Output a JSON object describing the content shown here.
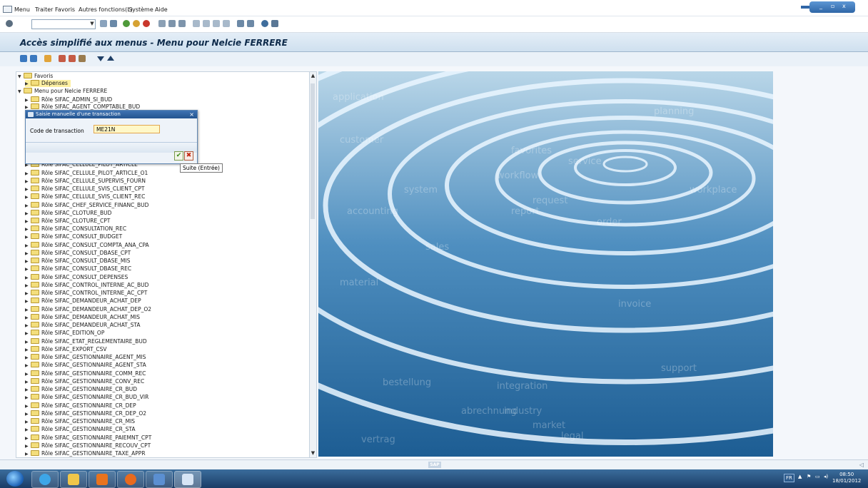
{
  "menubar": {
    "items": [
      "Menu",
      "Traiter",
      "Favoris",
      "Autres fonctions(L)",
      "Système",
      "Aide"
    ]
  },
  "window": {
    "minimize": "_",
    "restore": "▫",
    "close": "x"
  },
  "toolbar": {
    "command_field_value": ""
  },
  "title": "Accès simplifié aux menus  -  Menu pour Nelcie FERRERE",
  "tree": {
    "items": [
      "Favoris",
      "Dépenses",
      "Menu pour Nelcie FERRERE",
      "Rôle SIFAC_ADMIN_SI_BUD",
      "Rôle SIFAC_AGENT_COMPTABLE_BUD",
      "Rôle SIFAC_CELLULE_PILOT_ARTICLE",
      "Rôle SIFAC_CELLULE_PILOT_ARTICLE_O1",
      "Rôle SIFAC_CELLULE_SUPERVIS_FOURN",
      "Rôle SIFAC_CELLULE_SVIS_CLIENT_CPT",
      "Rôle SIFAC_CELLULE_SVIS_CLIENT_REC",
      "Rôle SIFAC_CHEF_SERVICE_FINANC_BUD",
      "Rôle SIFAC_CLOTURE_BUD",
      "Rôle SIFAC_CLOTURE_CPT",
      "Rôle SIFAC_CONSULTATION_REC",
      "Rôle SIFAC_CONSULT_BUDGET",
      "Rôle SIFAC_CONSULT_COMPTA_ANA_CPA",
      "Rôle SIFAC_CONSULT_DBASE_CPT",
      "Rôle SIFAC_CONSULT_DBASE_MIS",
      "Rôle SIFAC_CONSULT_DBASE_REC",
      "Rôle SIFAC_CONSULT_DEPENSES",
      "Rôle SIFAC_CONTROL_INTERNE_AC_BUD",
      "Rôle SIFAC_CONTROL_INTERNE_AC_CPT",
      "Rôle SIFAC_DEMANDEUR_ACHAT_DEP",
      "Rôle SIFAC_DEMANDEUR_ACHAT_DEP_O2",
      "Rôle SIFAC_DEMANDEUR_ACHAT_MIS",
      "Rôle SIFAC_DEMANDEUR_ACHAT_STA",
      "Rôle SIFAC_EDITION_OP",
      "Rôle SIFAC_ETAT_REGLEMENTAIRE_BUD",
      "Rôle SIFAC_EXPORT_CSV",
      "Rôle SIFAC_GESTIONNAIRE_AGENT_MIS",
      "Rôle SIFAC_GESTIONNAIRE_AGENT_STA",
      "Rôle SIFAC_GESTIONNAIRE_COMM_REC",
      "Rôle SIFAC_GESTIONNAIRE_CONV_REC",
      "Rôle SIFAC_GESTIONNAIRE_CR_BUD",
      "Rôle SIFAC_GESTIONNAIRE_CR_BUD_VIR",
      "Rôle SIFAC_GESTIONNAIRE_CR_DEP",
      "Rôle SIFAC_GESTIONNAIRE_CR_DEP_O2",
      "Rôle SIFAC_GESTIONNAIRE_CR_MIS",
      "Rôle SIFAC_GESTIONNAIRE_CR_STA",
      "Rôle SIFAC_GESTIONNAIRE_PAIEMNT_CPT",
      "Rôle SIFAC_GESTIONNAIRE_RECOUV_CPT",
      "Rôle SIFAC_GESTIONNAIRE_TAXE_APPR"
    ]
  },
  "dialog": {
    "title": "Saisie manuelle d'une transaction",
    "close": "×",
    "field_label": "Code de transaction",
    "field_value": "ME21N",
    "ok": "✔",
    "cancel": "✖",
    "tooltip": "Suite  (Entrée)"
  },
  "splash": {
    "words": [
      "application",
      "favorites",
      "service",
      "workflow",
      "order",
      "report",
      "system",
      "request",
      "vertrag",
      "bestellung",
      "abrechnung",
      "integration",
      "customer",
      "planning",
      "workplace",
      "invoice",
      "material",
      "industry",
      "support",
      "legal",
      "sales",
      "market",
      "accounting"
    ]
  },
  "statusbar": {
    "sap_logo": "SAP"
  },
  "taskbar": {
    "language": "FR",
    "time": "08:50",
    "date": "18/01/2012"
  }
}
